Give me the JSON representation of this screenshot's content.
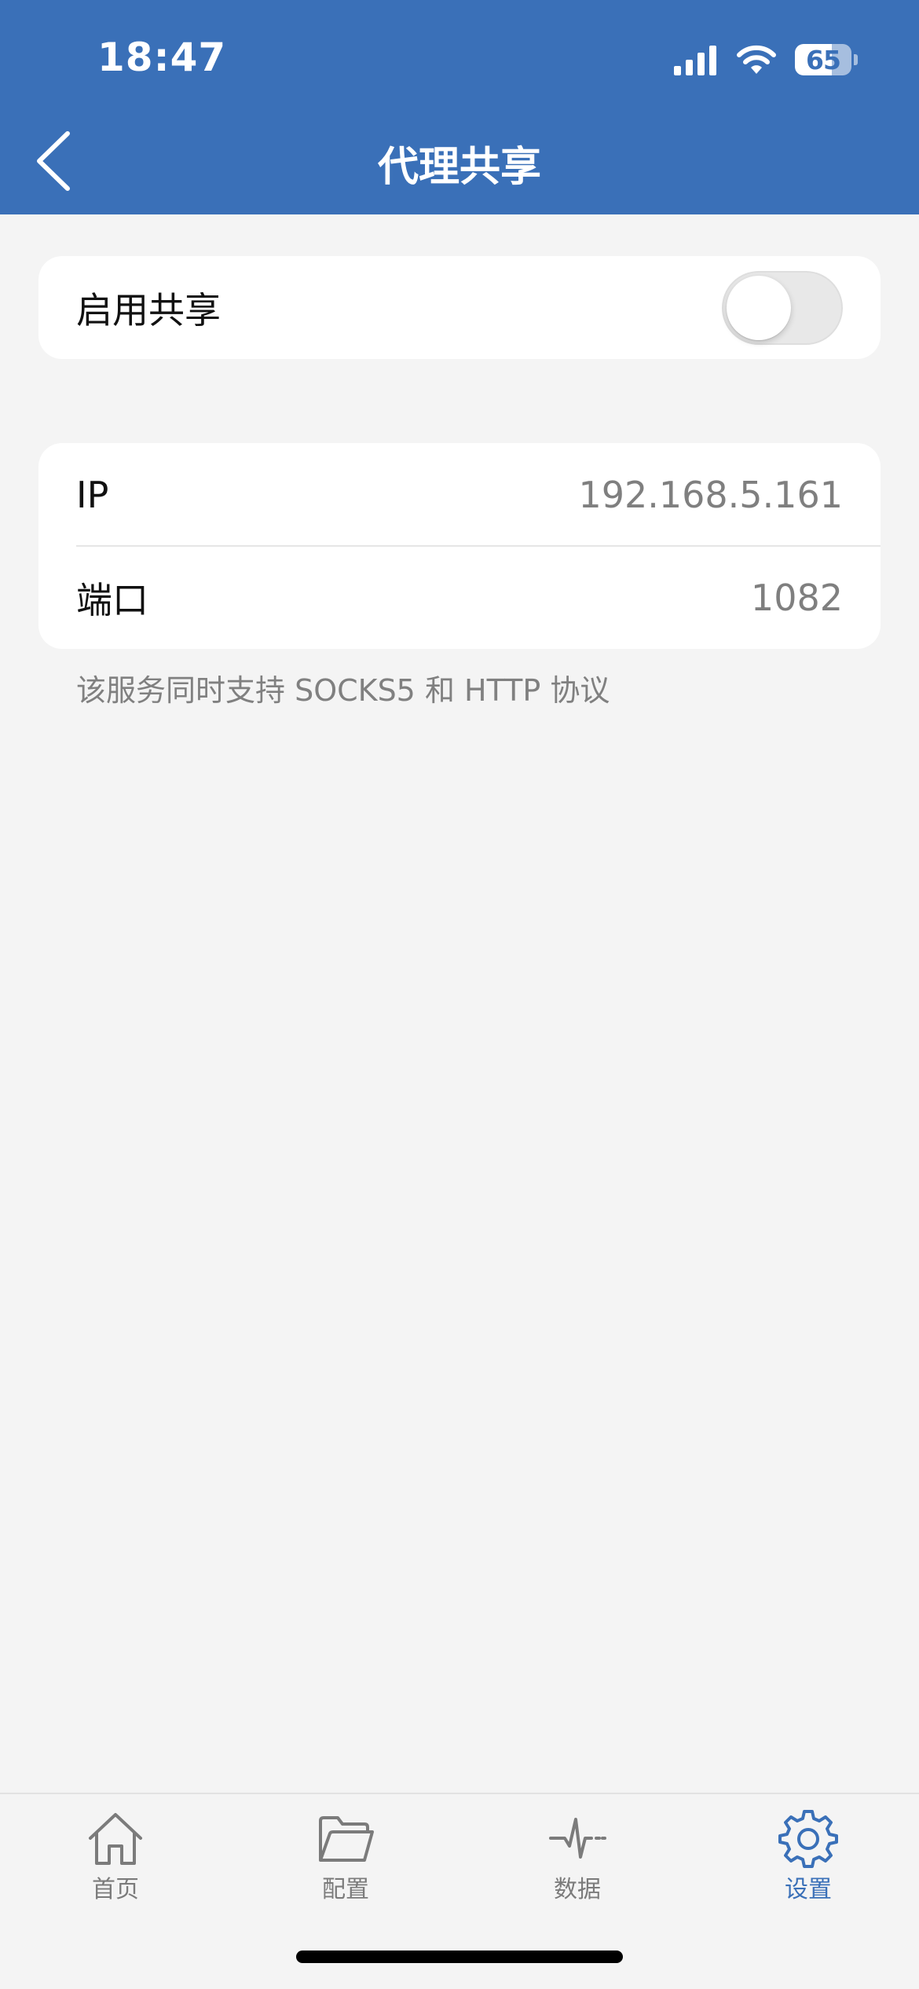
{
  "status_bar": {
    "time": "18:47",
    "battery_level": "65",
    "battery_fraction": 0.65
  },
  "header": {
    "title": "代理共享",
    "back_icon": "chevron-left-icon"
  },
  "share_card": {
    "enable_label": "启用共享",
    "enabled": false
  },
  "info_card": {
    "ip_label": "IP",
    "ip_value": "192.168.5.161",
    "port_label": "端口",
    "port_value": "1082"
  },
  "footnote": "该服务同时支持 SOCKS5 和 HTTP 协议",
  "tabbar": {
    "items": [
      {
        "label": "首页",
        "icon": "home-icon",
        "active": false
      },
      {
        "label": "配置",
        "icon": "folder-icon",
        "active": false
      },
      {
        "label": "数据",
        "icon": "activity-icon",
        "active": false
      },
      {
        "label": "设置",
        "icon": "gear-icon",
        "active": true
      }
    ]
  },
  "colors": {
    "header_bg": "#3a70b8",
    "accent": "#3a70b8",
    "page_bg": "#f4f4f4",
    "inactive_tab": "#7b7b7b"
  }
}
